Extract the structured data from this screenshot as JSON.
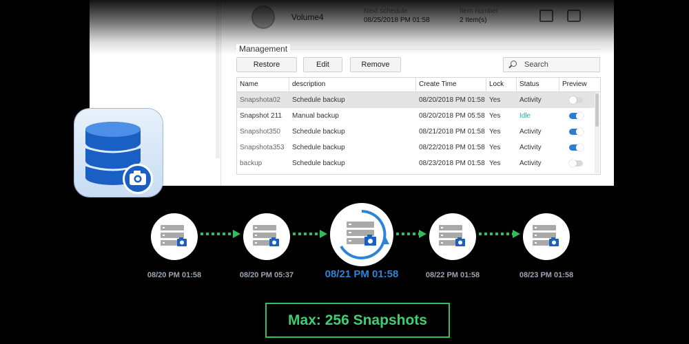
{
  "volume": {
    "name": "Volume4",
    "col1_label": "Next schedule",
    "col1_value": "08/25/2018 PM 01:58",
    "col2_label": "Item number",
    "col2_value": "2 Item(s)"
  },
  "management": {
    "title": "Management",
    "buttons": {
      "restore": "Restore",
      "edit": "Edit",
      "remove": "Remove"
    },
    "search_label": "Search"
  },
  "table": {
    "headers": [
      "Name",
      "description",
      "Create Time",
      "Lock",
      "Status",
      "Preview"
    ],
    "rows": [
      {
        "name": "Snapshota02",
        "description": "Schedule backup",
        "create_time": "08/20/2018 PM 01:58",
        "lock": "Yes",
        "status": "Activity",
        "preview": false
      },
      {
        "name": "Snapshot 211",
        "description": "Manual backup",
        "create_time": "08/20/2018 PM 05:58",
        "lock": "Yes",
        "status": "Idle",
        "preview": true
      },
      {
        "name": "Snapshot350",
        "description": "Schedule backup",
        "create_time": "08/21/2018 PM 01:58",
        "lock": "Yes",
        "status": "Activity",
        "preview": true
      },
      {
        "name": "Snapshota353",
        "description": "Schedule backup",
        "create_time": "08/22/2018 PM 01:58",
        "lock": "Yes",
        "status": "Activity",
        "preview": true
      },
      {
        "name": "backup",
        "description": "Schedule backup",
        "create_time": "08/23/2018 PM 01:58",
        "lock": "Yes",
        "status": "Activity",
        "preview": false
      }
    ]
  },
  "timeline": {
    "labels": [
      "08/20 PM 01:58",
      "08/20 PM 05:37",
      "08/21 PM 01:58",
      "08/22 PM 01:58",
      "08/23 PM 01:58"
    ]
  },
  "max_label": "Max: 256 Snapshots",
  "colors": {
    "accent": "#2d84d6",
    "arrow": "#2fbf5a",
    "idle": "#23b7a0",
    "toggle_on": "#2a7fd4"
  },
  "icons": [
    "database-icon",
    "camera-icon",
    "server-icon",
    "restore-arrow-icon",
    "search-icon",
    "calendar-icon"
  ]
}
